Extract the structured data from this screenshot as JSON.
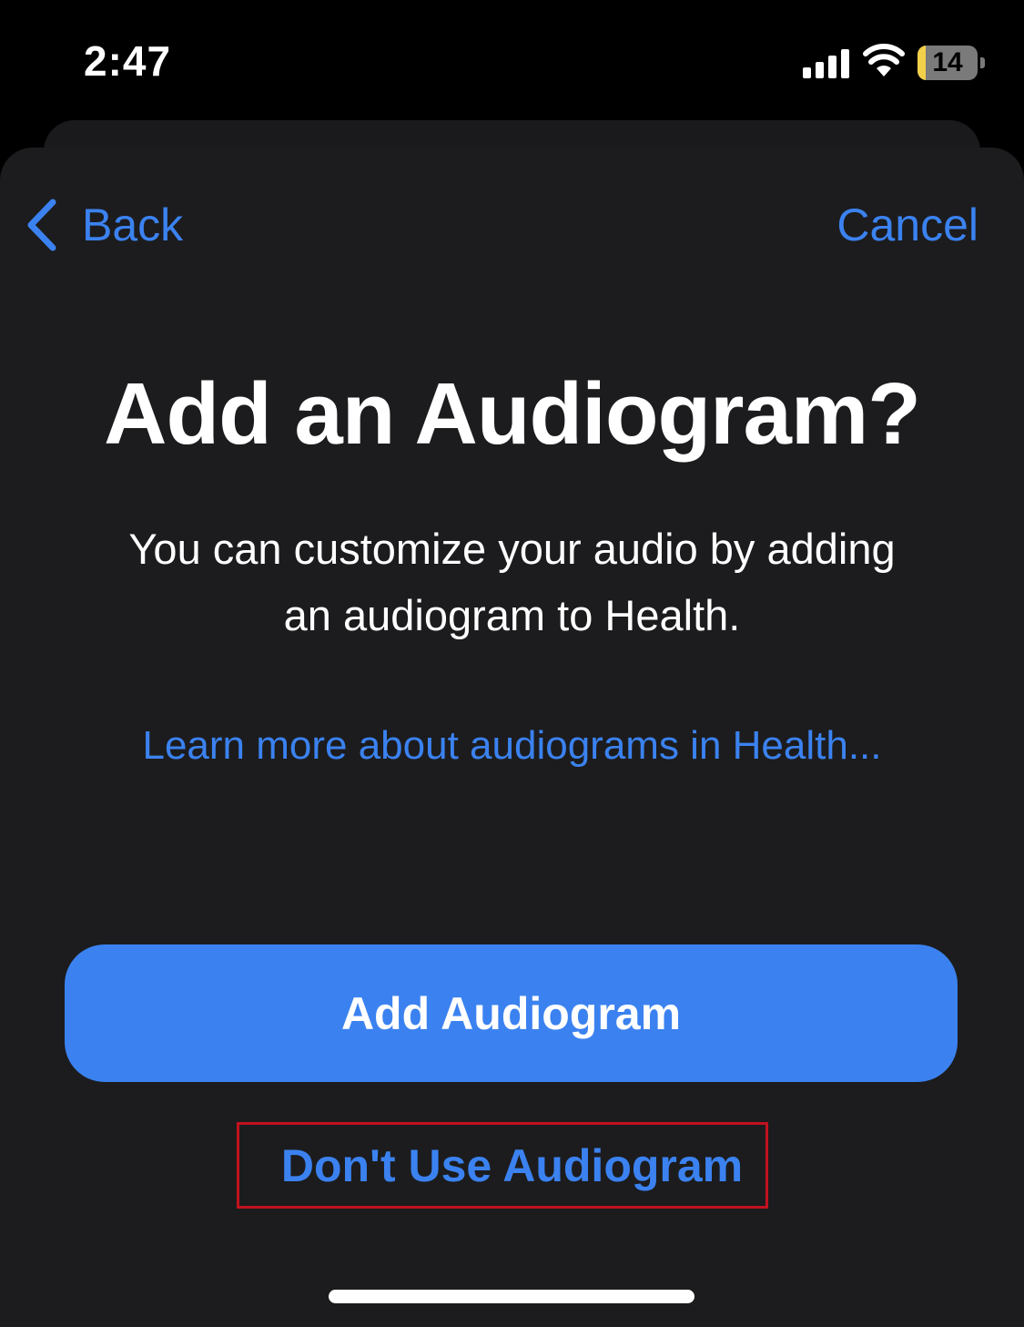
{
  "status_bar": {
    "time": "2:47",
    "battery_level": "14",
    "battery_fraction": 0.14,
    "battery_color": "#f2d04a",
    "icons": [
      "signal-icon",
      "wifi-icon",
      "battery-icon"
    ]
  },
  "nav": {
    "back_label": "Back",
    "back_icon": "chevron-left-icon",
    "cancel_label": "Cancel"
  },
  "content": {
    "title": "Add an Audiogram?",
    "subtitle_line1": "You can customize your audio by adding",
    "subtitle_line2": "an audiogram to Health.",
    "learn_more_link": "Learn more about audiograms in Health..."
  },
  "actions": {
    "primary_label": "Add Audiogram",
    "secondary_label": "Don't Use Audiogram"
  },
  "colors": {
    "accent": "#3b82f0",
    "sheet_background": "#1c1c1e",
    "highlight_border": "#c1121f"
  }
}
